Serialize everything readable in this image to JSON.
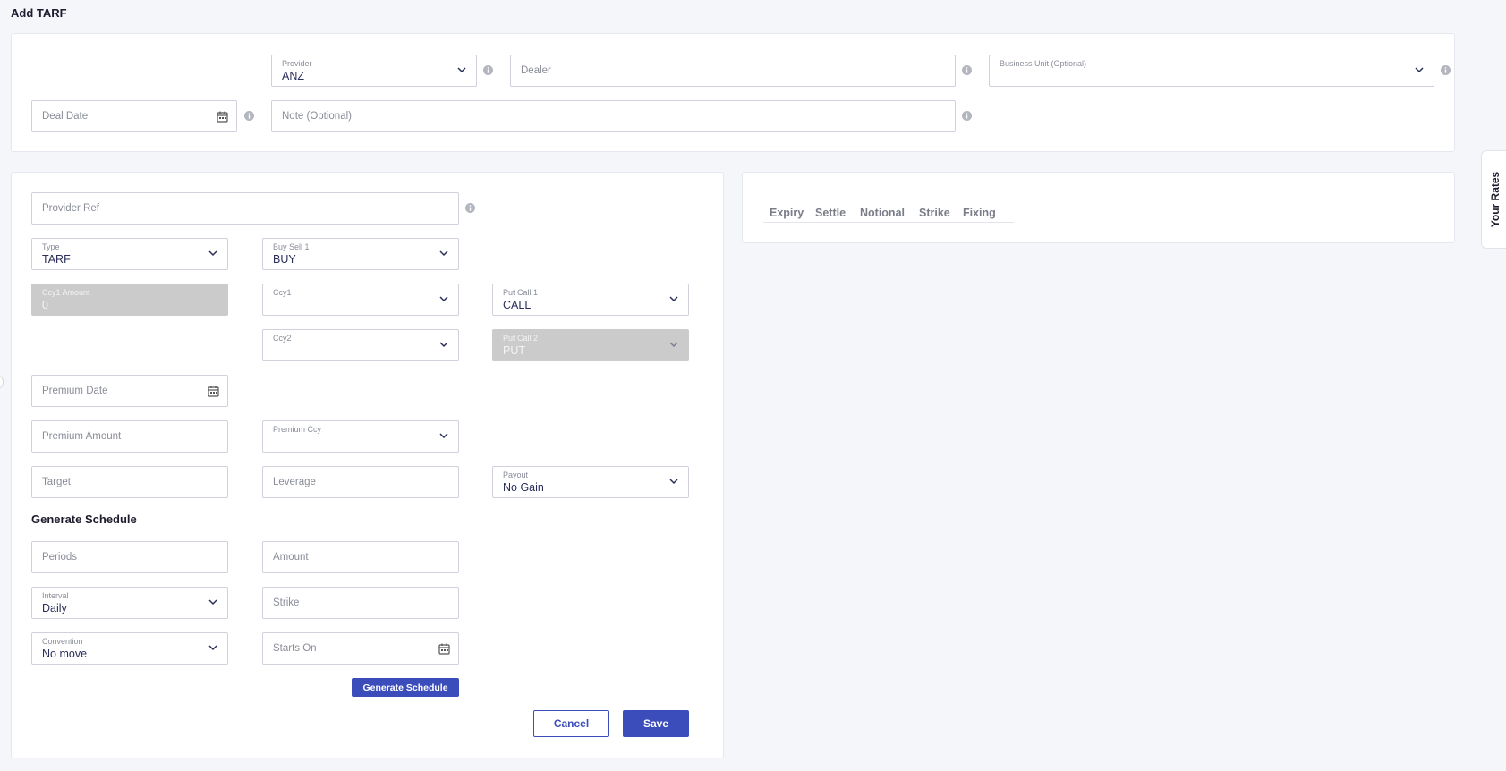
{
  "page_title": "Add TARF",
  "top_form": {
    "provider": {
      "label": "Provider",
      "value": "ANZ"
    },
    "dealer": {
      "placeholder": "Dealer"
    },
    "business_unit": {
      "label": "Business Unit (Optional)"
    },
    "deal_date": {
      "placeholder": "Deal Date"
    },
    "note": {
      "placeholder": "Note (Optional)"
    }
  },
  "deal_form": {
    "provider_ref": {
      "placeholder": "Provider Ref"
    },
    "type": {
      "label": "Type",
      "value": "TARF"
    },
    "buy_sell_1": {
      "label": "Buy Sell 1",
      "value": "BUY"
    },
    "ccy1_amount": {
      "label": "Ccy1 Amount",
      "value": "0"
    },
    "ccy1": {
      "label": "Ccy1"
    },
    "put_call_1": {
      "label": "Put Call 1",
      "value": "CALL"
    },
    "ccy2": {
      "label": "Ccy2"
    },
    "put_call_2": {
      "label": "Put Call 2",
      "value": "PUT"
    },
    "premium_date": {
      "placeholder": "Premium Date"
    },
    "premium_amount": {
      "placeholder": "Premium Amount"
    },
    "premium_ccy": {
      "label": "Premium Ccy"
    },
    "target": {
      "placeholder": "Target"
    },
    "leverage": {
      "placeholder": "Leverage"
    },
    "payout": {
      "label": "Payout",
      "value": "No Gain"
    }
  },
  "schedule": {
    "title": "Generate Schedule",
    "periods": {
      "placeholder": "Periods"
    },
    "amount": {
      "placeholder": "Amount"
    },
    "interval": {
      "label": "Interval",
      "value": "Daily"
    },
    "strike": {
      "placeholder": "Strike"
    },
    "convention": {
      "label": "Convention",
      "value": "No move"
    },
    "starts_on": {
      "placeholder": "Starts On"
    },
    "generate_button": "Generate Schedule"
  },
  "actions": {
    "cancel": "Cancel",
    "save": "Save"
  },
  "schedule_table": {
    "columns": [
      "Expiry",
      "Settle",
      "Notional",
      "Strike",
      "Fixing"
    ]
  },
  "side_tab": "Your Rates",
  "colors": {
    "primary": "#3b4dbb",
    "disabled": "#cbcbcb",
    "background": "#f5f6fa"
  }
}
